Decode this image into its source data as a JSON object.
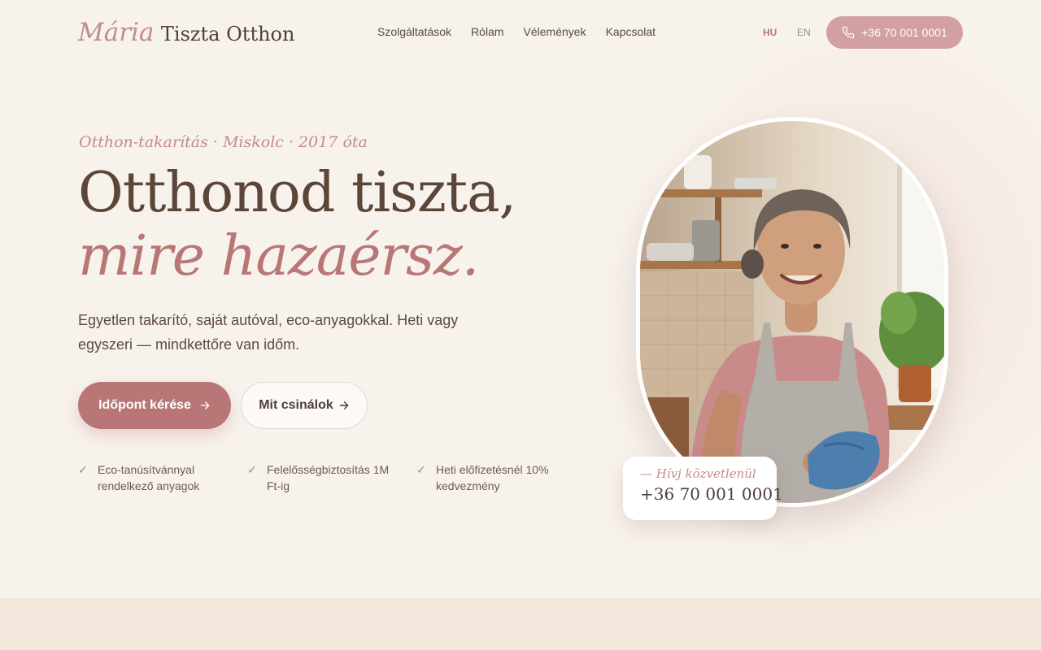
{
  "brand": {
    "script": "Mária",
    "name": "Tiszta Otthon"
  },
  "nav": {
    "items": [
      "Szolgáltatások",
      "Rólam",
      "Vélemények",
      "Kapcsolat"
    ]
  },
  "lang": {
    "hu": "HU",
    "en": "EN",
    "active": "HU"
  },
  "header": {
    "phone": "+36 70 001 0001",
    "phone_icon": "phone-icon"
  },
  "hero": {
    "eyebrow": "Otthon-takarítás · Miskolc · 2017 óta",
    "headline_line1": "Otthonod tiszta,",
    "headline_line2": "mire hazaérsz.",
    "lead": "Egyetlen takarító, saját autóval, eco-anyagokkal. Heti vagy egyszeri — mindkettőre van időm.",
    "primary_cta": "Időpont kérése",
    "secondary_cta": "Mit csinálok",
    "features": [
      "Eco-tanúsítvánnyal rendelkező anyagok",
      "Felelősségbiztosítás 1M Ft-ig",
      "Heti előfizetésnél 10% kedvezmény"
    ]
  },
  "call_card": {
    "label": "— Hívj közvetlenül",
    "number": "+36 70 001 0001"
  },
  "colors": {
    "background": "#f8f2ec",
    "accent_rose": "#b97676",
    "accent_light": "#d2a0a0",
    "text_dark": "#5b4639",
    "check_green": "#7a9a84"
  }
}
